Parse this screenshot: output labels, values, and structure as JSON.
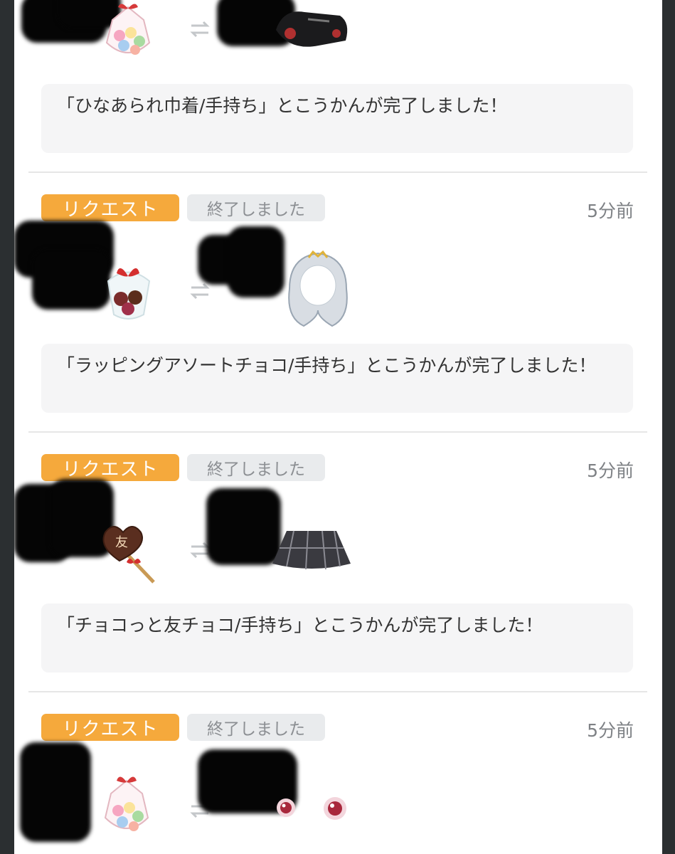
{
  "feed": {
    "entries": [
      {
        "badge_request": "",
        "badge_status": "",
        "time": "",
        "item_icon": "candy-pouch",
        "received_icon": "black-glove",
        "message": "「ひなあられ巾着/手持ち」とこうかんが完了しました！"
      },
      {
        "badge_request": "リクエスト",
        "badge_status": "終了しました",
        "time": "5分前",
        "item_icon": "wrapped-chocolate-bouquet",
        "received_icon": "silver-curly-hair",
        "message": "「ラッピングアソートチョコ/手持ち」とこうかんが完了しました！"
      },
      {
        "badge_request": "リクエスト",
        "badge_status": "終了しました",
        "time": "5分前",
        "item_icon": "heart-chocolate-stick",
        "received_icon": "plaid-skirt",
        "message": "「チョコっと友チョコ/手持ち」とこうかんが完了しました！"
      },
      {
        "badge_request": "リクエスト",
        "badge_status": "終了しました",
        "time": "5分前",
        "item_icon": "candy-pouch",
        "received_icon": "red-eyes",
        "message": ""
      }
    ],
    "swap_icon": "swap-arrows-icon",
    "colors": {
      "request_badge": "#f5a93c",
      "ended_badge": "#e9ebed",
      "message_box": "#f5f5f6"
    }
  }
}
